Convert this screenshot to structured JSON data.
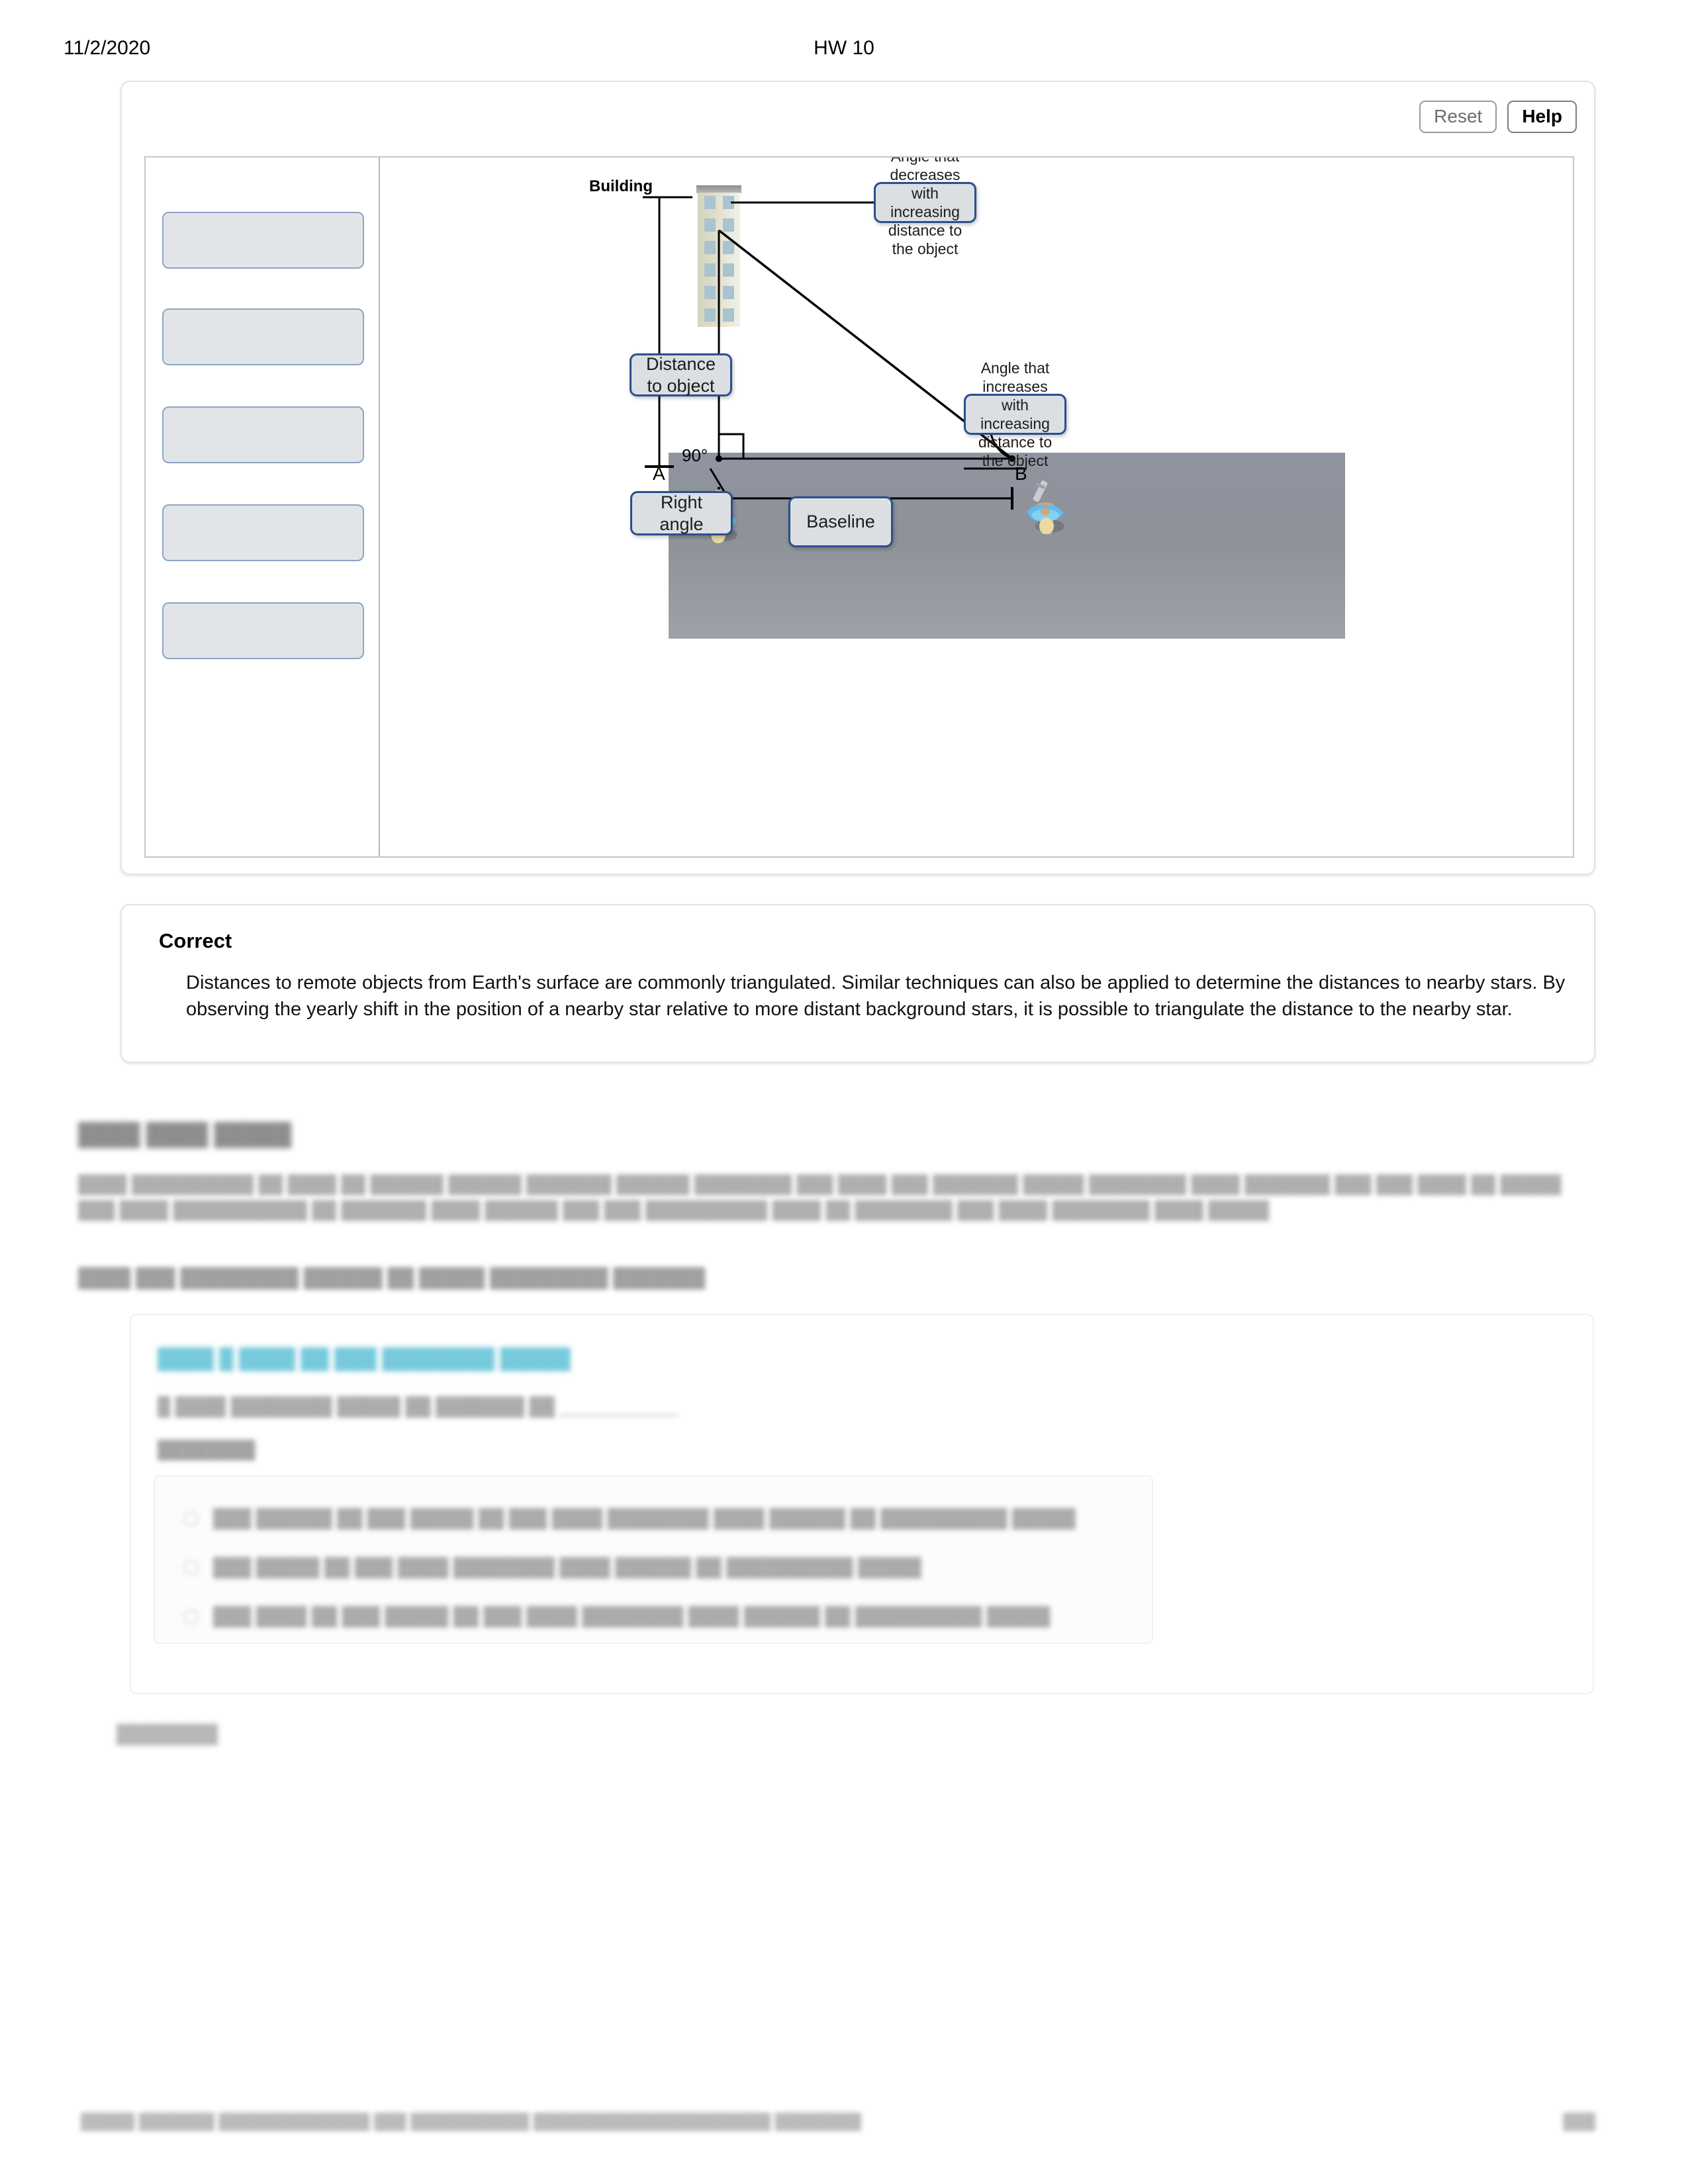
{
  "header": {
    "date": "11/2/2020",
    "title": "HW 10"
  },
  "toolbar": {
    "reset_label": "Reset",
    "help_label": "Help"
  },
  "diagram": {
    "building_label": "Building",
    "right_angle_value": "90°",
    "point_a_label": "A",
    "point_b_label": "B",
    "chips": {
      "distance": "Distance to object",
      "right_angle": "Right angle",
      "baseline": "Baseline",
      "angle_decreases": "Angle that decreases with increasing distance to the object",
      "angle_increases": "Angle that increases with increasing distance to the object"
    },
    "bank_slots": [
      "",
      "",
      "",
      "",
      ""
    ]
  },
  "feedback": {
    "status": "Correct",
    "body": "Distances to remote objects from Earth's surface are commonly triangulated. Similar techniques can also be applied to determine the distances to nearby stars. By observing the yearly shift in the position of a nearby star relative to more distant background stars, it is possible to triangulate the distance to the nearby star."
  },
  "obscured": {
    "section_heading": "████ ████ █████",
    "section_paragraph": "████ ██████████ ██ ████ ██ ██████ ██████ ███████ ██████ ████████ ███ ████ ███ ███████ █████ ████████ ████ ███████ ███ ███ ████ ██ █████ ███ ████ ███████████ ██ ███████ ████ ██████ ███ ███ ██████████ ████ ██ ████████ ███ ████ ████████ ████ █████",
    "section_instruction": "████ ███ █████████ ██████ ██ █████ █████████ ███████",
    "question_heading": "████ █ ████ ██ ███ ████████ █████",
    "question_stem": "█ ████ ████████ █████ ██ ███████ ██ ____________",
    "answer_label": "████████",
    "options": [
      "███ ██████ ██ ███ █████ ██ ███ ████ ████████ ████ ██████ ██ ██████████ █████",
      "███ █████ ██ ███ ████ ████████ ████ ██████ ██ ██████████ █████",
      "███ ████ ██ ███ █████ ██ ███ ████ ████████ ████ ██████ ██ ██████████ █████"
    ],
    "submit_label": "████████",
    "footer_url": "█████ ███████ ██████████████ ███ ███████████ ██████████████████████ ████████",
    "footer_page": "███"
  }
}
